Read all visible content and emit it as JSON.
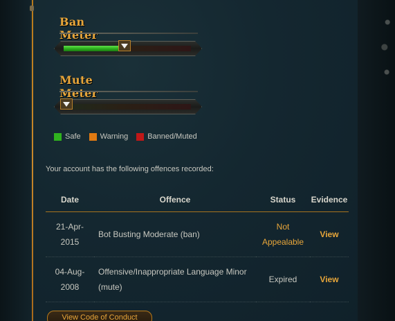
{
  "ban_meter": {
    "title": "Ban Meter",
    "level": 0.48
  },
  "mute_meter": {
    "title": "Mute Meter",
    "level": 0.02
  },
  "legend": [
    {
      "label": "Safe",
      "color": "#2fb21e"
    },
    {
      "label": "Warning",
      "color": "#e07a12"
    },
    {
      "label": "Banned/Muted",
      "color": "#c01818"
    }
  ],
  "intro_text": "Your account has the following offences recorded:",
  "table": {
    "headers": [
      "Date",
      "Offence",
      "Status",
      "Evidence"
    ],
    "rows": [
      {
        "date": "21-Apr-2015",
        "offence": "Bot Busting Moderate (ban)",
        "status": "Not Appealable",
        "evidence": "View"
      },
      {
        "date": "04-Aug-2008",
        "offence": "Offensive/Inappropriate Language Minor (mute)",
        "status": "Expired",
        "evidence": "View"
      }
    ]
  },
  "conduct_button": "View Code of Conduct"
}
